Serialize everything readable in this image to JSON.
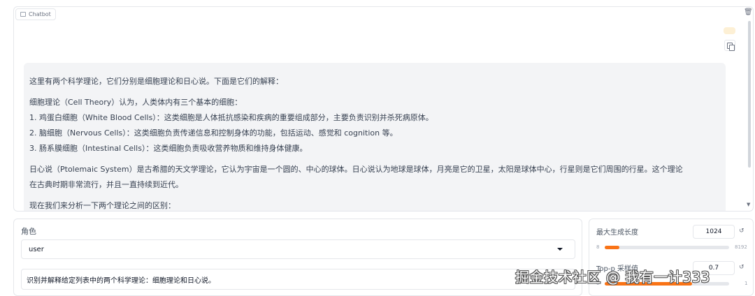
{
  "chatbot": {
    "label": "Chatbot",
    "messages": {
      "intro": "这里有两个科学理论，它们分别是细胞理论和日心说。下面是它们的解释：",
      "cell_heading": "细胞理论（Cell Theory）认为，人类体内有三个基本的细胞：",
      "item1": "1. 鸡蛋白细胞（White Blood Cells）：这类细胞是人体抵抗感染和疾病的重要组成部分，主要负责识别并杀死病原体。",
      "item2": "2. 脑细胞（Nervous Cells）：这类细胞负责传递信息和控制身体的功能，包括运动、感觉和 cognition 等。",
      "item3": "3. 肠系膜细胞（Intestinal Cells）：这类细胞负责吸收营养物质和维持身体健康。",
      "helio_line1": "日心说（Ptolemaic System）是古希腊的天文学理论，它认为宇宙是一个圆的、中心的球体。日心说认为地球是球体，月亮是它的卫星，太阳是球体中心，行星则是它们周围的行星。这个理论",
      "helio_line2": "在古典时期非常流行，并且一直持续到近代。",
      "analysis": "现在我们来分析一下两个理论之间的区别："
    }
  },
  "input": {
    "role_label": "角色",
    "role_value": "user",
    "prompt_text": "识别并解释给定列表中的两个科学理论：细胞理论和日心说。"
  },
  "settings": {
    "max_length": {
      "label": "最大生成长度",
      "value": "1024",
      "min": "8",
      "max": "8192",
      "fill_fraction": 0.12
    },
    "top_p": {
      "label": "Top-p 采样值",
      "value": "0.7",
      "min": "0",
      "max": "1",
      "fill_fraction": 0.7
    }
  },
  "watermark": "掘金技术社区 @ 我有一计333",
  "colors": {
    "accent": "#f97316",
    "bubble": "#fdf0d5",
    "message_bg": "#f3f4f6"
  }
}
